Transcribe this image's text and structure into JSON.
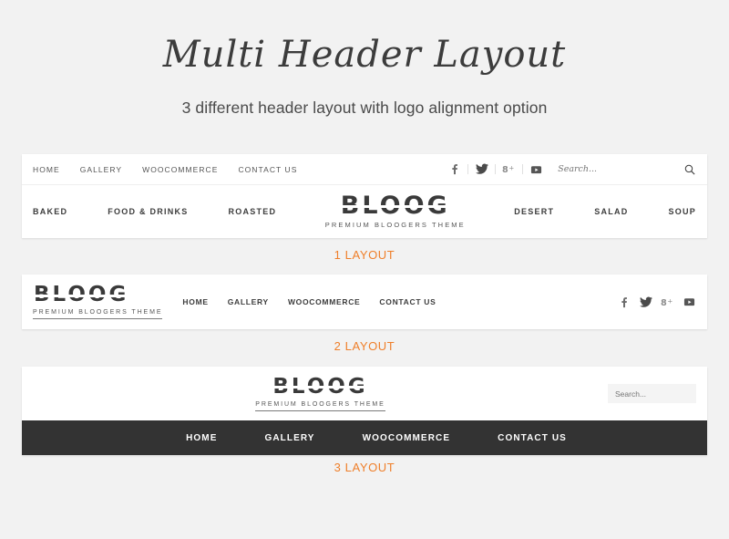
{
  "page": {
    "title": "Multi Header Layout",
    "subtitle": "3 different header layout with logo alignment option",
    "background_color": "#f2f2f2",
    "accent_color": "#ef7f2a"
  },
  "brand": {
    "name": "BLOOG",
    "tagline": "PREMIUM BLOOGERS THEME"
  },
  "search": {
    "placeholder": "Search...",
    "value": ""
  },
  "social": [
    {
      "name": "facebook",
      "glyph": "f"
    },
    {
      "name": "twitter",
      "glyph": "t"
    },
    {
      "name": "google-plus",
      "glyph": "g+"
    },
    {
      "name": "youtube",
      "glyph": "yt"
    }
  ],
  "layouts": [
    {
      "caption": "1 LAYOUT",
      "top_menu": [
        "HOME",
        "GALLERY",
        "WOOCOMMERCE",
        "CONTACT US"
      ],
      "left_menu": [
        "BAKED",
        "FOOD & DRINKS",
        "ROASTED"
      ],
      "right_menu": [
        "DESERT",
        "SALAD",
        "SOUP"
      ]
    },
    {
      "caption": "2 LAYOUT",
      "menu": [
        "HOME",
        "GALLERY",
        "WOOCOMMERCE",
        "CONTACT US"
      ]
    },
    {
      "caption": "3 LAYOUT",
      "menu": [
        "HOME",
        "GALLERY",
        "WOOCOMMERCE",
        "CONTACT US"
      ],
      "nav_background": "#333333"
    }
  ]
}
